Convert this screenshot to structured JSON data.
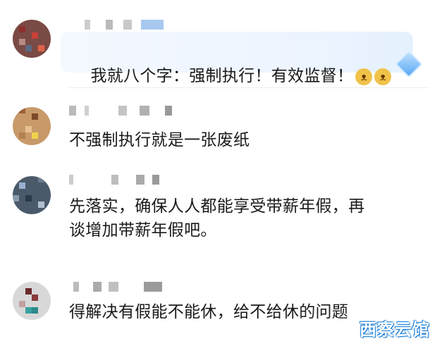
{
  "comments": [
    {
      "text": "我就八个字：强制执行！有效监督！",
      "emojis": [
        "dog-emoji",
        "dog-emoji"
      ],
      "badge": "diamond-badge-icon"
    },
    {
      "text": "不强制执行就是一张废纸"
    },
    {
      "text": "先落实，确保人人都能享受带薪年假，再\n谈增加带薪年假吧。"
    },
    {
      "text": "得解决有假能不能休，给不给休的问题"
    }
  ],
  "watermark": "西察云馆",
  "colors": {
    "bubble": "#eef5ff",
    "accent": "#1e7fd8"
  }
}
